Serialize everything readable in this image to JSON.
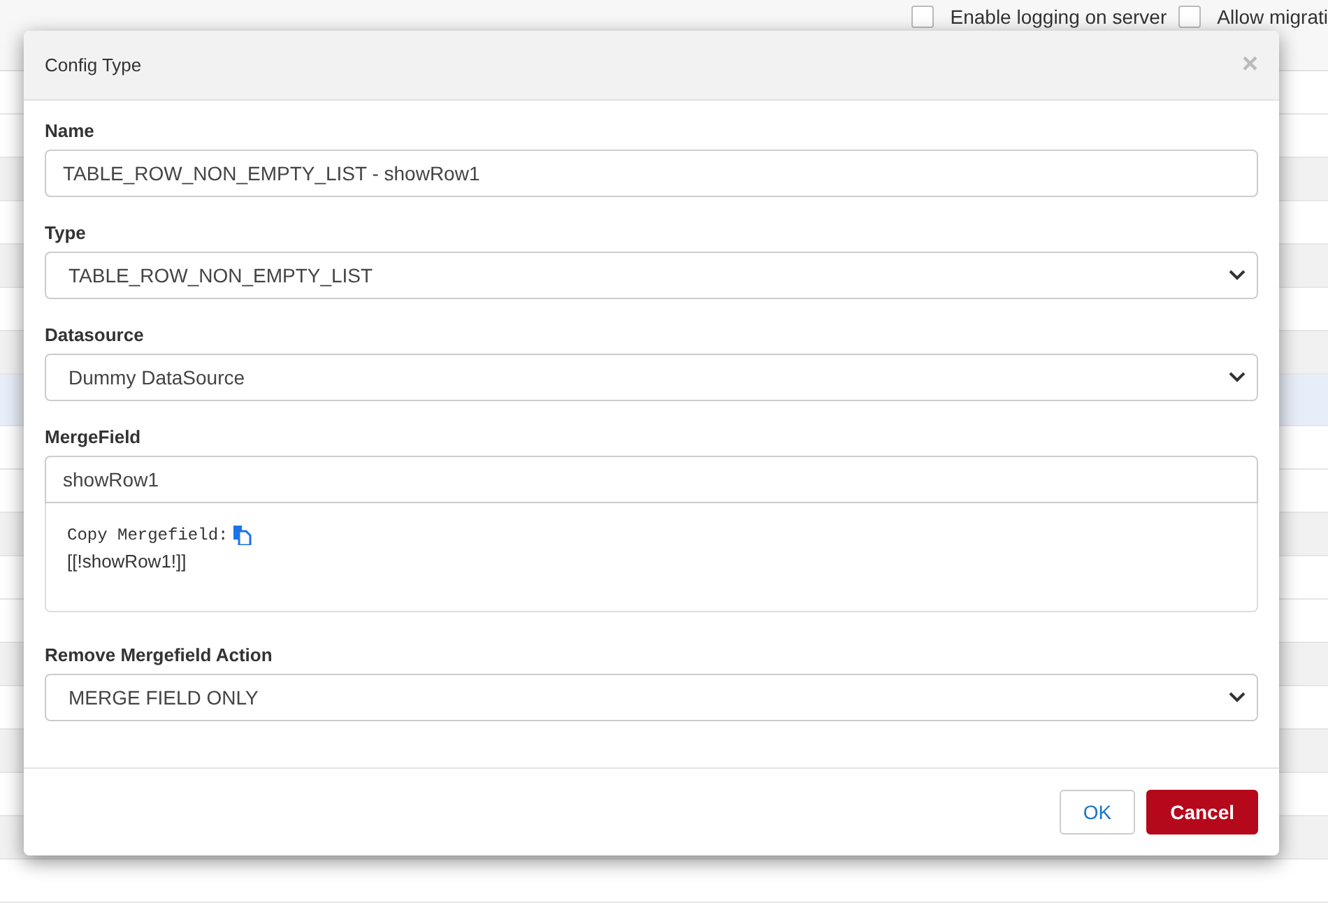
{
  "background": {
    "options": [
      {
        "label": "Enable logging on server",
        "checked": false
      },
      {
        "label": "Allow migrati",
        "checked": false
      }
    ]
  },
  "dialog": {
    "title": "Config Type",
    "close": "×",
    "fields": [
      {
        "kind": "text",
        "label": "Name",
        "value": "TABLE_ROW_NON_EMPTY_LIST - showRow1"
      },
      {
        "kind": "select",
        "label": "Type",
        "value": "TABLE_ROW_NON_EMPTY_LIST"
      },
      {
        "kind": "select",
        "label": "Datasource",
        "value": "Dummy DataSource"
      },
      {
        "kind": "mergefield",
        "label": "MergeField",
        "value": "showRow1",
        "copy_label": "Copy Mergefield:",
        "snippet": "[[!showRow1!]]"
      },
      {
        "kind": "select",
        "label": "Remove Mergefield Action",
        "value": "MERGE FIELD ONLY"
      }
    ],
    "buttons": [
      {
        "label": "OK",
        "kind": "secondary"
      },
      {
        "label": "Cancel",
        "kind": "danger"
      }
    ]
  }
}
